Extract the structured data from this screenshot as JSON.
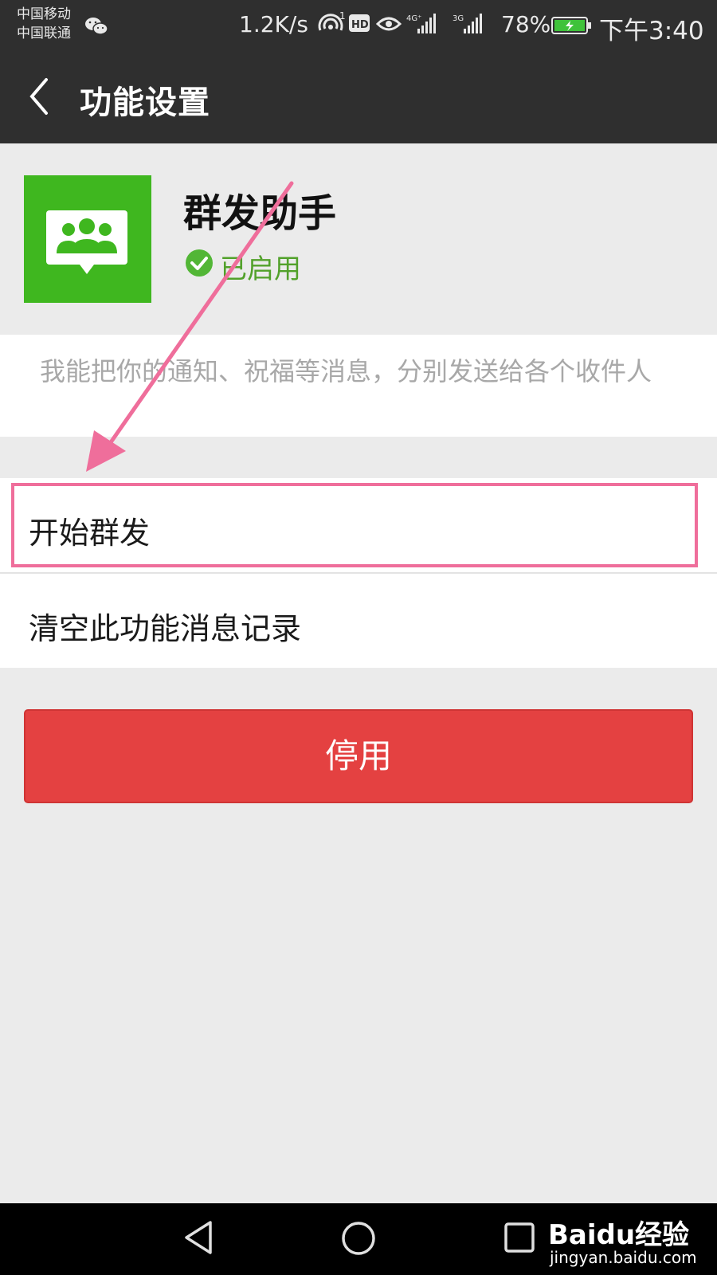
{
  "status_bar": {
    "carrier_1": "中国移动",
    "carrier_2": "中国联通",
    "net_speed": "1.2K/s",
    "hd_badge": "HD",
    "signal_4g": "4G⁺",
    "signal_3g": "3G",
    "battery_percent": "78%",
    "time": "下午3:40"
  },
  "nav": {
    "title": "功能设置"
  },
  "plugin": {
    "name": "群发助手",
    "status": "已启用",
    "description": "我能把你的通知、祝福等消息，分别发送给各个收件人",
    "icon_color": "#3fb71f",
    "status_color": "#52a12b"
  },
  "menu": {
    "items": [
      {
        "label": "开始群发"
      },
      {
        "label": "清空此功能消息记录"
      }
    ]
  },
  "actions": {
    "disable_label": "停用",
    "disable_color": "#e44141"
  },
  "annotation": {
    "color": "#ef6e9b"
  },
  "watermark": {
    "brand": "Baidu经验",
    "url": "jingyan.baidu.com"
  }
}
